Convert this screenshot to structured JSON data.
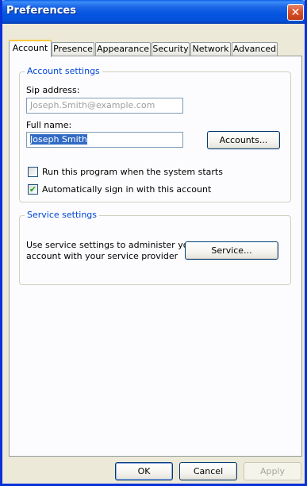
{
  "window": {
    "title": "Preferences",
    "close_glyph": "✕"
  },
  "tabs": [
    {
      "label": "Account",
      "active": true
    },
    {
      "label": "Presence"
    },
    {
      "label": "Appearance"
    },
    {
      "label": "Security"
    },
    {
      "label": "Network"
    },
    {
      "label": "Advanced"
    }
  ],
  "account_settings": {
    "group_title": "Account settings",
    "sip_label": "Sip address:",
    "sip_value": "Joseph.Smith@example.com",
    "fullname_label": "Full name:",
    "fullname_value": "Joseph Smith",
    "accounts_button": "Accounts...",
    "run_at_startup_label": "Run this program when the system starts",
    "run_at_startup_checked": false,
    "auto_signin_label": "Automatically sign in with this account",
    "auto_signin_checked": true,
    "check_glyph": "✔"
  },
  "service_settings": {
    "group_title": "Service settings",
    "description_line1": "Use service settings to administer you",
    "description_line2": "account with your service provider",
    "service_button": "Service..."
  },
  "footer": {
    "ok": "OK",
    "cancel": "Cancel",
    "apply": "Apply"
  }
}
